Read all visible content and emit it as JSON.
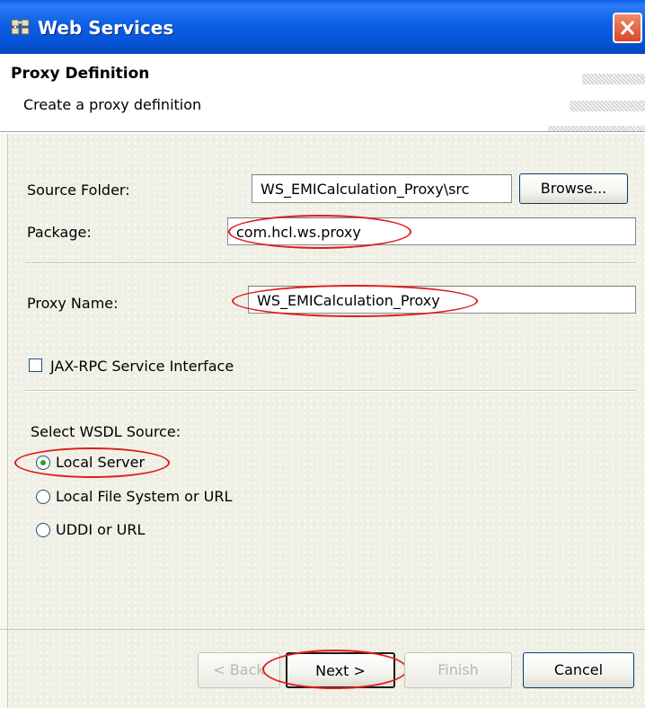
{
  "window": {
    "title": "Web Services",
    "app_icon": "web-services-icon",
    "close_icon": "close-icon"
  },
  "header": {
    "title": "Proxy Definition",
    "description": "Create a proxy definition"
  },
  "form": {
    "source_folder": {
      "label": "Source Folder:",
      "value": "WS_EMICalculation_Proxy\\src",
      "browse_label": "Browse..."
    },
    "package": {
      "label": "Package:",
      "value": "com.hcl.ws.proxy"
    },
    "proxy_name": {
      "label": "Proxy Name:",
      "value": "WS_EMICalculation_Proxy"
    },
    "jaxrpc": {
      "label": "JAX-RPC Service Interface",
      "checked": false
    },
    "wsdl_source": {
      "label": "Select WSDL Source:",
      "options": [
        {
          "label": "Local Server",
          "selected": true
        },
        {
          "label": "Local File System or URL",
          "selected": false
        },
        {
          "label": "UDDI or URL",
          "selected": false
        }
      ]
    }
  },
  "buttons": {
    "back": "< Back",
    "next": "Next >",
    "finish": "Finish",
    "cancel": "Cancel"
  },
  "colors": {
    "titlebar": "#0a5ee8",
    "annotation": "#e01b1b",
    "body": "#efefe5"
  }
}
